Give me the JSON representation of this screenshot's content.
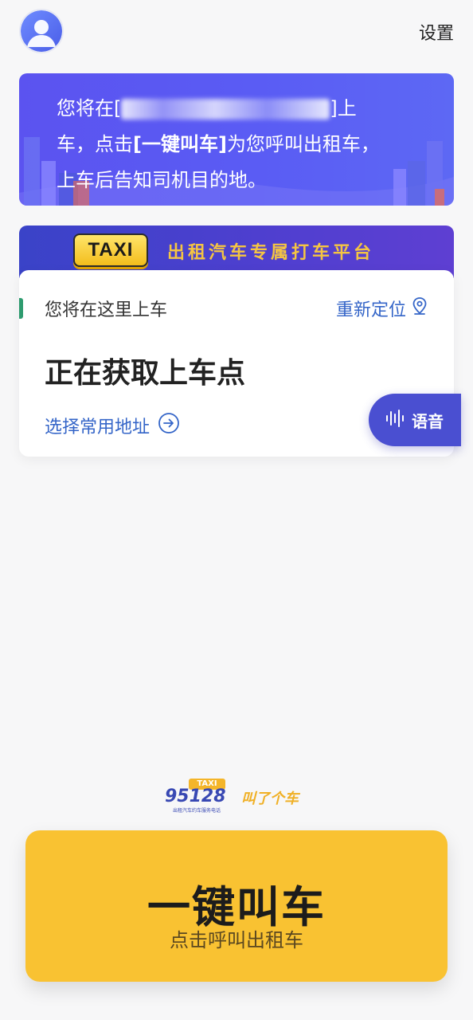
{
  "header": {
    "avatar_icon": "user-avatar-icon",
    "settings_label": "设置"
  },
  "banner": {
    "line1_prefix": "您将在[",
    "line1_suffix": "]上",
    "line2_prefix": "车，点击",
    "line2_bold": "[一键叫车]",
    "line2_suffix": "为您呼叫出租车，",
    "line3": "上车后告知司机目的地。"
  },
  "platform": {
    "taxi_sign": "TAXI",
    "title": "出租汽车专属打车平台"
  },
  "pickup_card": {
    "heading": "您将在这里上车",
    "relocate_label": "重新定位",
    "status": "正在获取上车点",
    "choose_label": "选择常用地址"
  },
  "voice_button": {
    "label": "语音"
  },
  "logo": {
    "tag": "TAXI",
    "number": "95128",
    "slogan": "叫了个车",
    "subtitle": "出租汽车约车服务电话"
  },
  "call_button": {
    "label": "一键叫车",
    "sublabel": "点击呼叫出租车"
  },
  "colors": {
    "accent_blue": "#3465c8",
    "call_yellow": "#f9c232",
    "banner_purple": "#5b53f0",
    "green_marker": "#2e9b6f"
  }
}
